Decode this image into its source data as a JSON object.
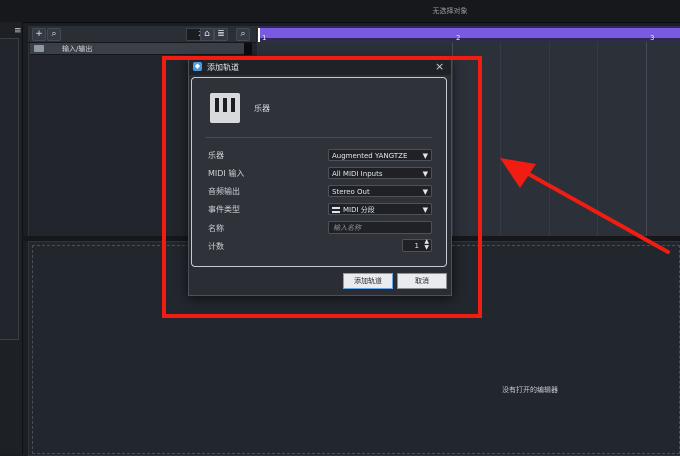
{
  "topbar": {
    "status": "无选择对象"
  },
  "left_rail": {
    "menu_icon": "hamburger-icon"
  },
  "track_toolbar": {
    "add_icon": "plus-icon",
    "search_icon": "search-icon",
    "counter": "2 / 2",
    "home_icon": "home-icon",
    "list_icon": "list-icon",
    "zoom_icon": "magnifier-icon"
  },
  "tracks": [
    {
      "label": "输入/输出",
      "icon": "folder-icon"
    }
  ],
  "ruler": {
    "marks": [
      "1",
      "2",
      "3"
    ]
  },
  "editor": {
    "empty_text": "没有打开的编辑器"
  },
  "dialog": {
    "title": "添加轨道",
    "icon": "app-icon",
    "close_icon": "close-icon",
    "instrument_icon": "piano-icon",
    "instrument_label": "乐器",
    "fields": {
      "instrument": {
        "label": "乐器",
        "value": "Augmented YANGTZE"
      },
      "midi_input": {
        "label": "MIDI 输入",
        "value": "All MIDI Inputs"
      },
      "audio_output": {
        "label": "音频输出",
        "value": "Stereo Out"
      },
      "event_type": {
        "label": "事件类型",
        "value": "MIDI 分段"
      },
      "name": {
        "label": "名称",
        "placeholder": "输入名称"
      },
      "count": {
        "label": "计数",
        "value": "1"
      }
    },
    "add_button": "添加轨道",
    "cancel_button": "取消"
  },
  "annotation": {
    "color": "#f21d12"
  }
}
